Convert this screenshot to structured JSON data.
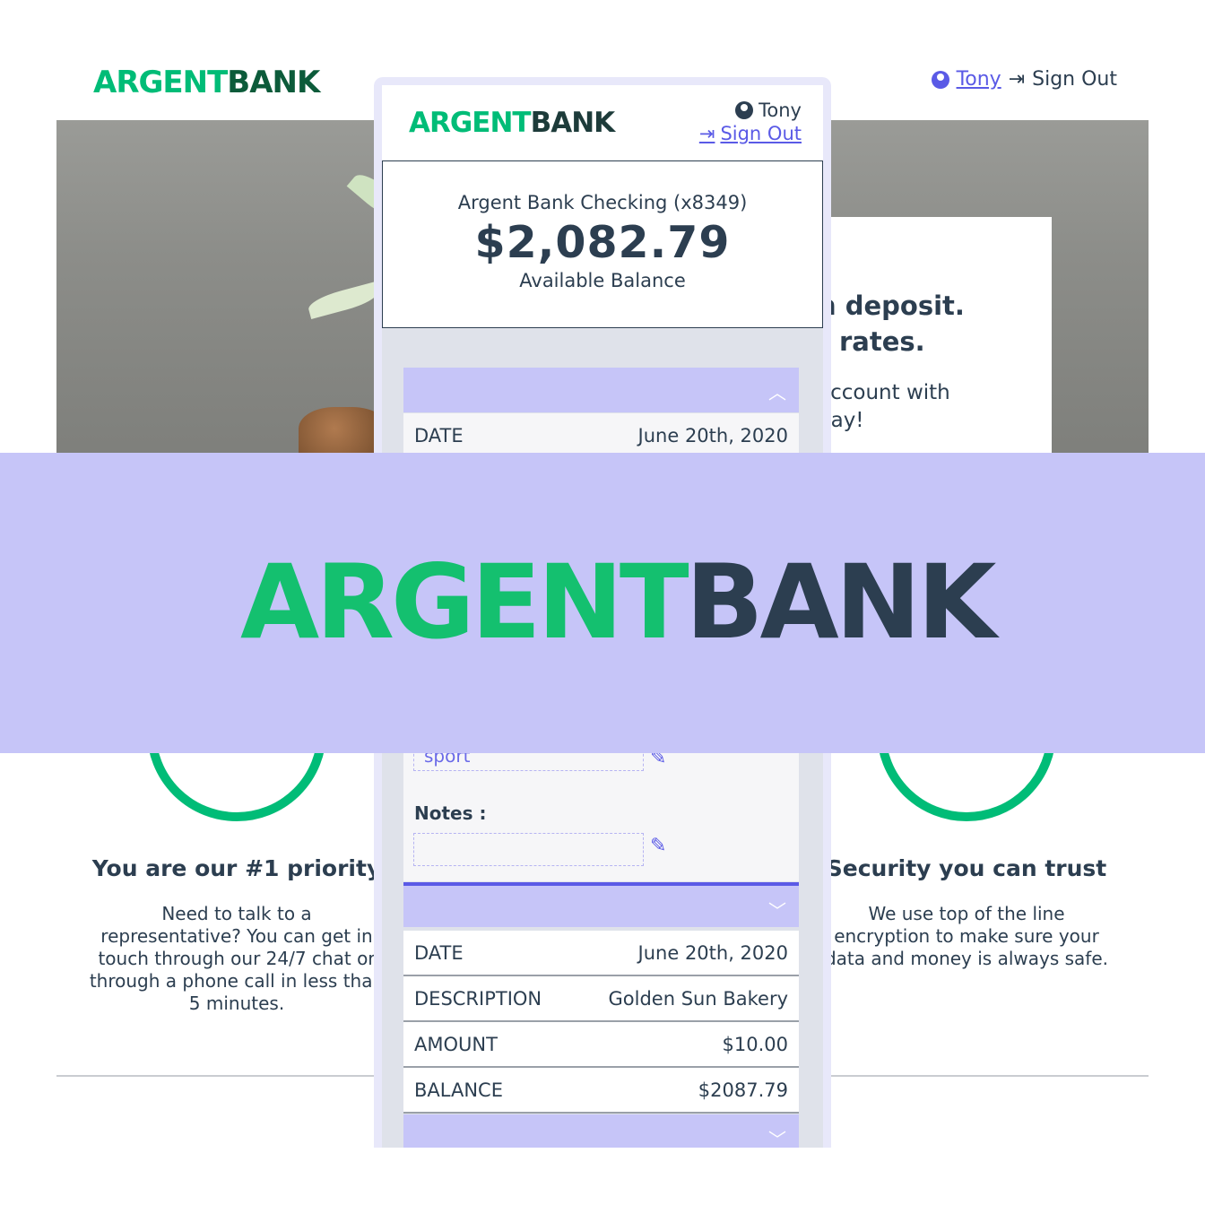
{
  "brand": {
    "part1": "ARGENT",
    "part2": "BANK"
  },
  "desktop": {
    "user_name": "Tony",
    "sign_out": "Sign Out",
    "hero_line1": "n deposit.",
    "hero_line2": "t rates.",
    "hero_line3": "account with",
    "hero_line4": "day!",
    "feature_left": {
      "title": "You are our #1 priority",
      "text": "Need to talk to a representative? You can get in touch through our 24/7 chat or through a phone call in less than 5 minutes."
    },
    "feature_right": {
      "title": "Security you can trust",
      "text": "We use top of the line encryption to make sure your data and money is always safe."
    }
  },
  "mobile": {
    "user_name": "Tony",
    "sign_out": "Sign Out",
    "account_title": "Argent Bank Checking (x8349)",
    "balance": "$2,082.79",
    "balance_label": "Available Balance",
    "tx1": {
      "date_label": "DATE",
      "date": "June 20th, 2020"
    },
    "edit": {
      "category_value": "sport",
      "notes_label": "Notes :"
    },
    "tx2": {
      "date_label": "DATE",
      "date": "June 20th, 2020",
      "desc_label": "DESCRIPTION",
      "desc": "Golden Sun Bakery",
      "amount_label": "AMOUNT",
      "amount": "$10.00",
      "balance_label": "BALANCE",
      "balance": "$2087.79"
    }
  },
  "colors": {
    "accent": "#00bc77",
    "purple": "#c6c5f8",
    "link": "#5a5ae6",
    "text": "#2c3e50"
  }
}
